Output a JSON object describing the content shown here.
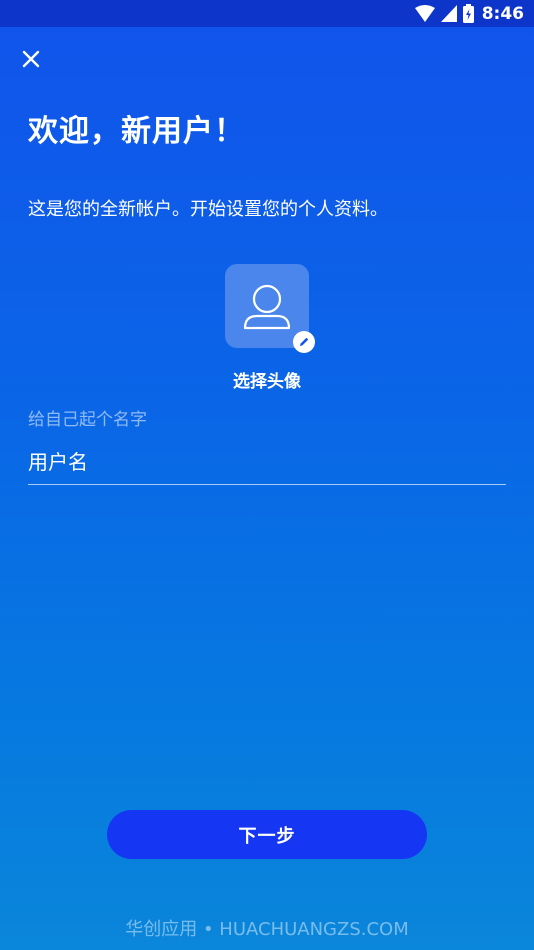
{
  "status_bar": {
    "time": "8:46",
    "icons": [
      "wifi-icon",
      "signal-icon",
      "battery-icon"
    ]
  },
  "header": {
    "close_icon": "close-icon"
  },
  "main": {
    "title": "欢迎，新用户！",
    "subtitle": "这是您的全新帐户。开始设置您的个人资料。",
    "avatar": {
      "icon": "person-icon",
      "edit_icon": "pencil-icon",
      "label": "选择头像"
    },
    "name_field": {
      "label": "给自己起个名字",
      "placeholder": "用户名",
      "value": ""
    },
    "next_button": "下一步"
  },
  "watermark": "华创应用 • HUACHUANGZS.COM",
  "colors": {
    "background_top": "#1153ec",
    "background_bottom": "#0a86da",
    "status_bar": "#0d35c9",
    "button": "#1537f3",
    "avatar_tile": "#4a86ec"
  }
}
